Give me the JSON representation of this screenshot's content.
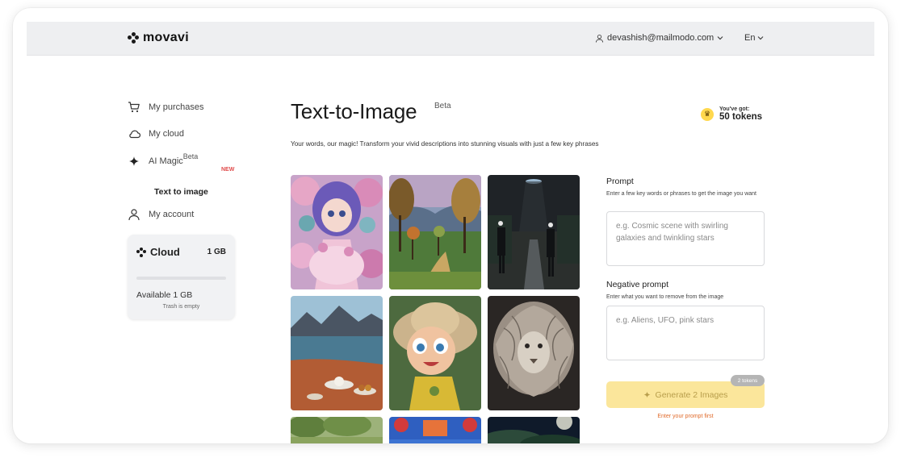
{
  "header": {
    "logo_text": "movavi",
    "user_email": "devashish@mailmodo.com",
    "language": "En"
  },
  "sidebar": {
    "items": [
      {
        "label": "My purchases",
        "icon": "cart-icon"
      },
      {
        "label": "My cloud",
        "icon": "cloud-icon"
      },
      {
        "label": "AI Magic",
        "sup": "Beta",
        "badge": "NEW",
        "icon": "sparkle-icon"
      },
      {
        "label": "My account",
        "icon": "user-icon"
      }
    ],
    "sub_item": "Text to image",
    "cloud_card": {
      "title": "Cloud",
      "size": "1 GB",
      "available": "Available 1 GB",
      "trash": "Trash is empty",
      "used_fraction": 0
    }
  },
  "main": {
    "title": "Text-to-Image",
    "title_sup": "Beta",
    "subtitle": "Your words, our magic! Transform your vivid descriptions into stunning visuals with just a few key phrases",
    "tokens_label": "You've got:",
    "tokens_count": "50 tokens",
    "gallery": [
      "fantasy-doll-image",
      "forest-painting-image",
      "two-men-ufo-image",
      "lake-picnic-image",
      "cartoon-boy-image",
      "lion-sculpture-image",
      "trees-image",
      "blue-sky-image",
      "night-sky-image"
    ]
  },
  "form": {
    "prompt_label": "Prompt",
    "prompt_hint": "Enter a few key words or phrases to get the image you want",
    "prompt_placeholder": "e.g. Cosmic scene with swirling galaxies and twinkling stars",
    "negative_label": "Negative prompt",
    "negative_hint": "Enter what you want to remove from the image",
    "negative_placeholder": "e.g. Aliens, UFO, pink stars",
    "generate_label": "Generate 2 Images",
    "generate_badge": "2 tokens",
    "generate_note": "Enter your prompt first"
  },
  "colors": {
    "accent_yellow": "#fbe69b",
    "new_badge": "#e04a4a",
    "note_orange": "#e06a2a"
  }
}
